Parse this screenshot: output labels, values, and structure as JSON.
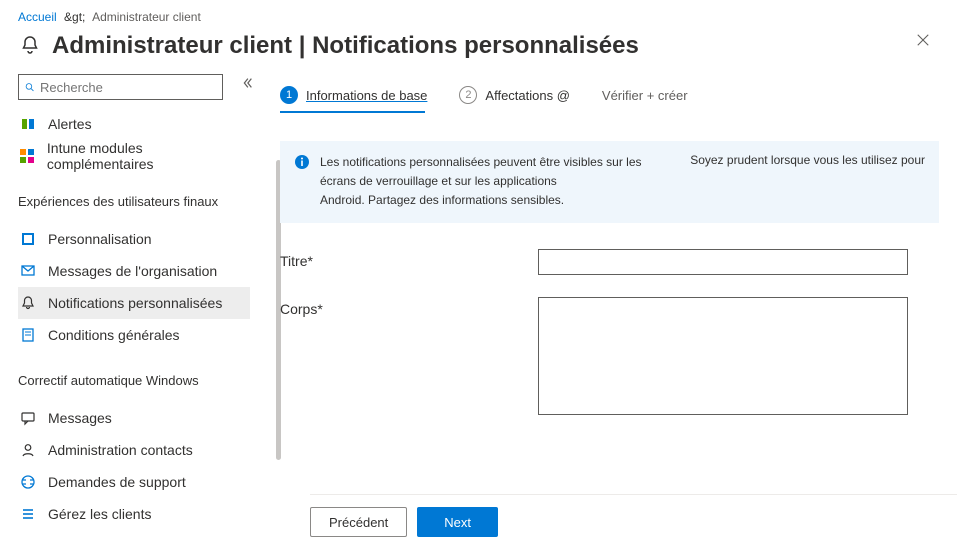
{
  "breadcrumb": {
    "home": "Accueil",
    "sep": "&gt;",
    "current": "Administrateur client"
  },
  "header": {
    "title": "Administrateur client | Notifications personnalisées"
  },
  "search": {
    "placeholder": "Recherche"
  },
  "nav": {
    "top": [
      {
        "label": "Alertes",
        "icon": "alerts"
      },
      {
        "label": "Intune modules complémentaires",
        "icon": "addons"
      }
    ],
    "section1_title": "Expériences des utilisateurs finaux",
    "section1": [
      {
        "label": "Personnalisation",
        "icon": "custom"
      },
      {
        "label": "Messages de l'organisation",
        "icon": "orgmsg"
      },
      {
        "label": "Notifications personnalisées",
        "icon": "bell",
        "active": true
      },
      {
        "label": "Conditions générales",
        "icon": "terms"
      }
    ],
    "section2_title": "Correctif automatique Windows",
    "section2": [
      {
        "label": "Messages",
        "icon": "msg"
      },
      {
        "label": "Administration contacts",
        "icon": "contact"
      },
      {
        "label": "Demandes de support",
        "icon": "support"
      },
      {
        "label": "Gérez les clients",
        "icon": "clients"
      }
    ]
  },
  "tabs": {
    "step1_num": "1",
    "step1_label": "Informations de base",
    "step2_num": "2",
    "step2_label": "Affectations @",
    "step3_label": "Vérifier + créer"
  },
  "banner": {
    "line1": "Les notifications personnalisées peuvent être visibles sur les écrans de verrouillage et sur les applications",
    "line2": "Android. Partagez des informations sensibles.",
    "right": "Soyez prudent lorsque vous les utilisez pour"
  },
  "form": {
    "title_label": "Titre*",
    "title_value": "",
    "body_label": "Corps*",
    "body_value": ""
  },
  "footer": {
    "prev": "Précédent",
    "next": "Next"
  }
}
